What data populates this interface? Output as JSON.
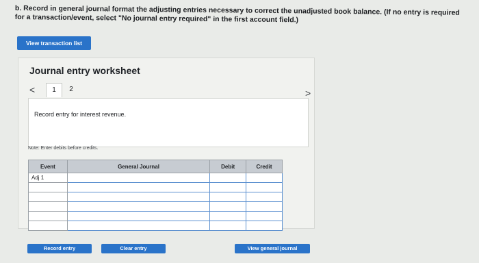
{
  "instructions": "b. Record in general journal format the adjusting entries necessary to correct the unadjusted book balance. (If no entry is required for a transaction/event, select \"No journal entry required\" in the first account field.)",
  "buttons": {
    "view_transaction_list": "View transaction list",
    "record_entry": "Record entry",
    "clear_entry": "Clear entry",
    "view_general_journal": "View general journal"
  },
  "worksheet": {
    "title": "Journal entry worksheet",
    "pages": [
      "1",
      "2"
    ],
    "current_page": "1",
    "description": "Record entry for interest revenue.",
    "note": "Note: Enter debits before credits."
  },
  "table": {
    "headers": [
      "Event",
      "General Journal",
      "Debit",
      "Credit"
    ],
    "rows": [
      [
        "Adj 1",
        "",
        "",
        ""
      ],
      [
        "",
        "",
        "",
        ""
      ],
      [
        "",
        "",
        "",
        ""
      ],
      [
        "",
        "",
        "",
        ""
      ],
      [
        "",
        "",
        "",
        ""
      ],
      [
        "",
        "",
        "",
        ""
      ]
    ]
  },
  "icons": {
    "prev": "chevron-left-icon",
    "next": "chevron-right-icon"
  },
  "colors": {
    "button_blue": "#2a73c9",
    "header_gray": "#c7ccd2"
  }
}
